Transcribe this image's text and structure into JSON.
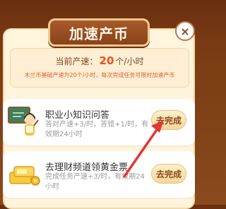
{
  "modal": {
    "title": "加速产币",
    "close_label": "×"
  },
  "rate": {
    "prefix": "当前产速：",
    "value": "20",
    "unit": "个/小时",
    "note": "木兰币基础产速为20个/小时，每次完成任务可限时加速产币"
  },
  "tasks": [
    {
      "title": "职业小知识问答",
      "desc": "答对产速+3/时，答错+1/时，有效期24小时",
      "button": "去完成",
      "icon": "teacher-avatar-icon"
    },
    {
      "title": "去理财频道领黄金票",
      "desc": "完成任务产速+3/时，有效期24小时",
      "button": "去完成",
      "icon": "gold-ticket-icon"
    }
  ],
  "annotation": {
    "arrow_color": "#e53535"
  }
}
